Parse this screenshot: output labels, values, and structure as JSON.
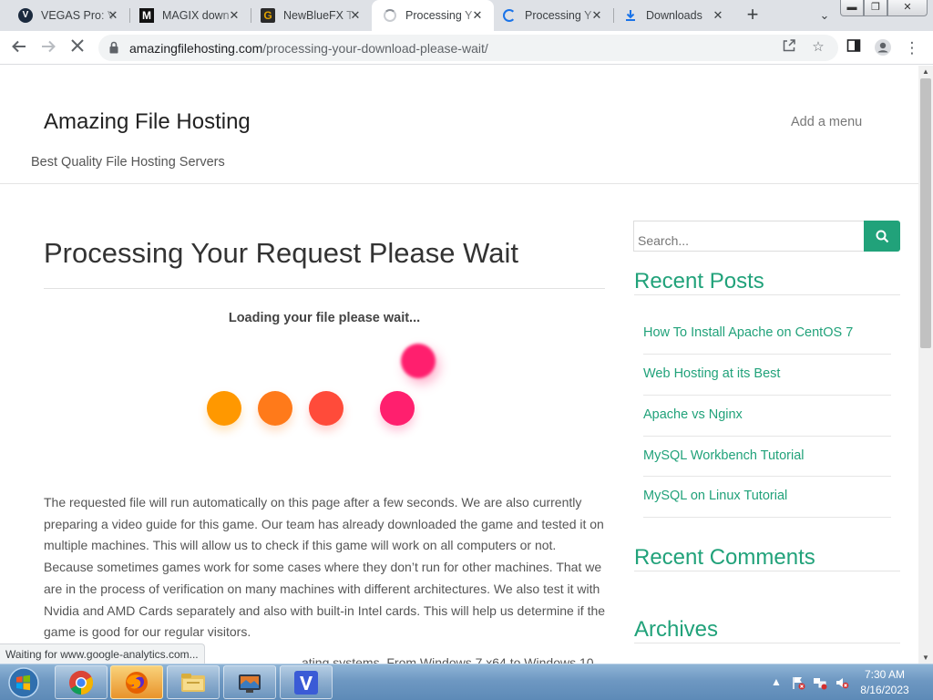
{
  "tabs": [
    {
      "title": "VEGAS Pro: V",
      "active": false
    },
    {
      "title": "MAGIX down",
      "active": false
    },
    {
      "title": "NewBlueFX T",
      "active": false
    },
    {
      "title": "Processing Y",
      "active": true
    },
    {
      "title": "Processing Y",
      "active": false
    },
    {
      "title": "Downloads",
      "active": false
    }
  ],
  "address_bar": {
    "domain": "amazingfilehosting.com",
    "path": "/processing-your-download-please-wait/"
  },
  "site": {
    "title": "Amazing File Hosting",
    "tagline": "Best Quality File Hosting Servers",
    "menu_label": "Add a menu"
  },
  "article": {
    "title": "Processing Your Request Please Wait",
    "loading_text": "Loading your file please wait...",
    "paragraph1": "The requested file will run automatically on this page after a few seconds. We are also currently preparing a video guide for this game. Our team has already downloaded the game and tested it on multiple machines. This will allow us to check if this game will work on all computers or not. Because sometimes games work for some cases where they don’t run for other machines. That we are in the process of verification on many machines with different architectures. We also test it with Nvidia and AMD Cards separately and also with built-in Intel cards. This will help us determine if the game is good for our regular visitors.",
    "paragraph2_partial": "ating systems. From Windows 7 x64 to Windows 10"
  },
  "loader_dots": {
    "colors": [
      "#ff9800",
      "#ff7a1a",
      "#ff4b3a",
      "#ff1f6e",
      "#ff1f6e"
    ]
  },
  "sidebar": {
    "search_placeholder": "Search...",
    "recent_posts_title": "Recent Posts",
    "recent_posts": [
      "How To Install Apache on CentOS 7",
      "Web Hosting at its Best",
      "Apache vs Nginx",
      "MySQL Workbench Tutorial",
      "MySQL on Linux Tutorial"
    ],
    "recent_comments_title": "Recent Comments",
    "archives_title": "Archives"
  },
  "status_text": "Waiting for www.google-analytics.com...",
  "taskbar": {
    "time": "7:30 AM",
    "date": "8/16/2023"
  },
  "colors": {
    "accent": "#21a27a",
    "tabstrip": "#dee1e6"
  }
}
